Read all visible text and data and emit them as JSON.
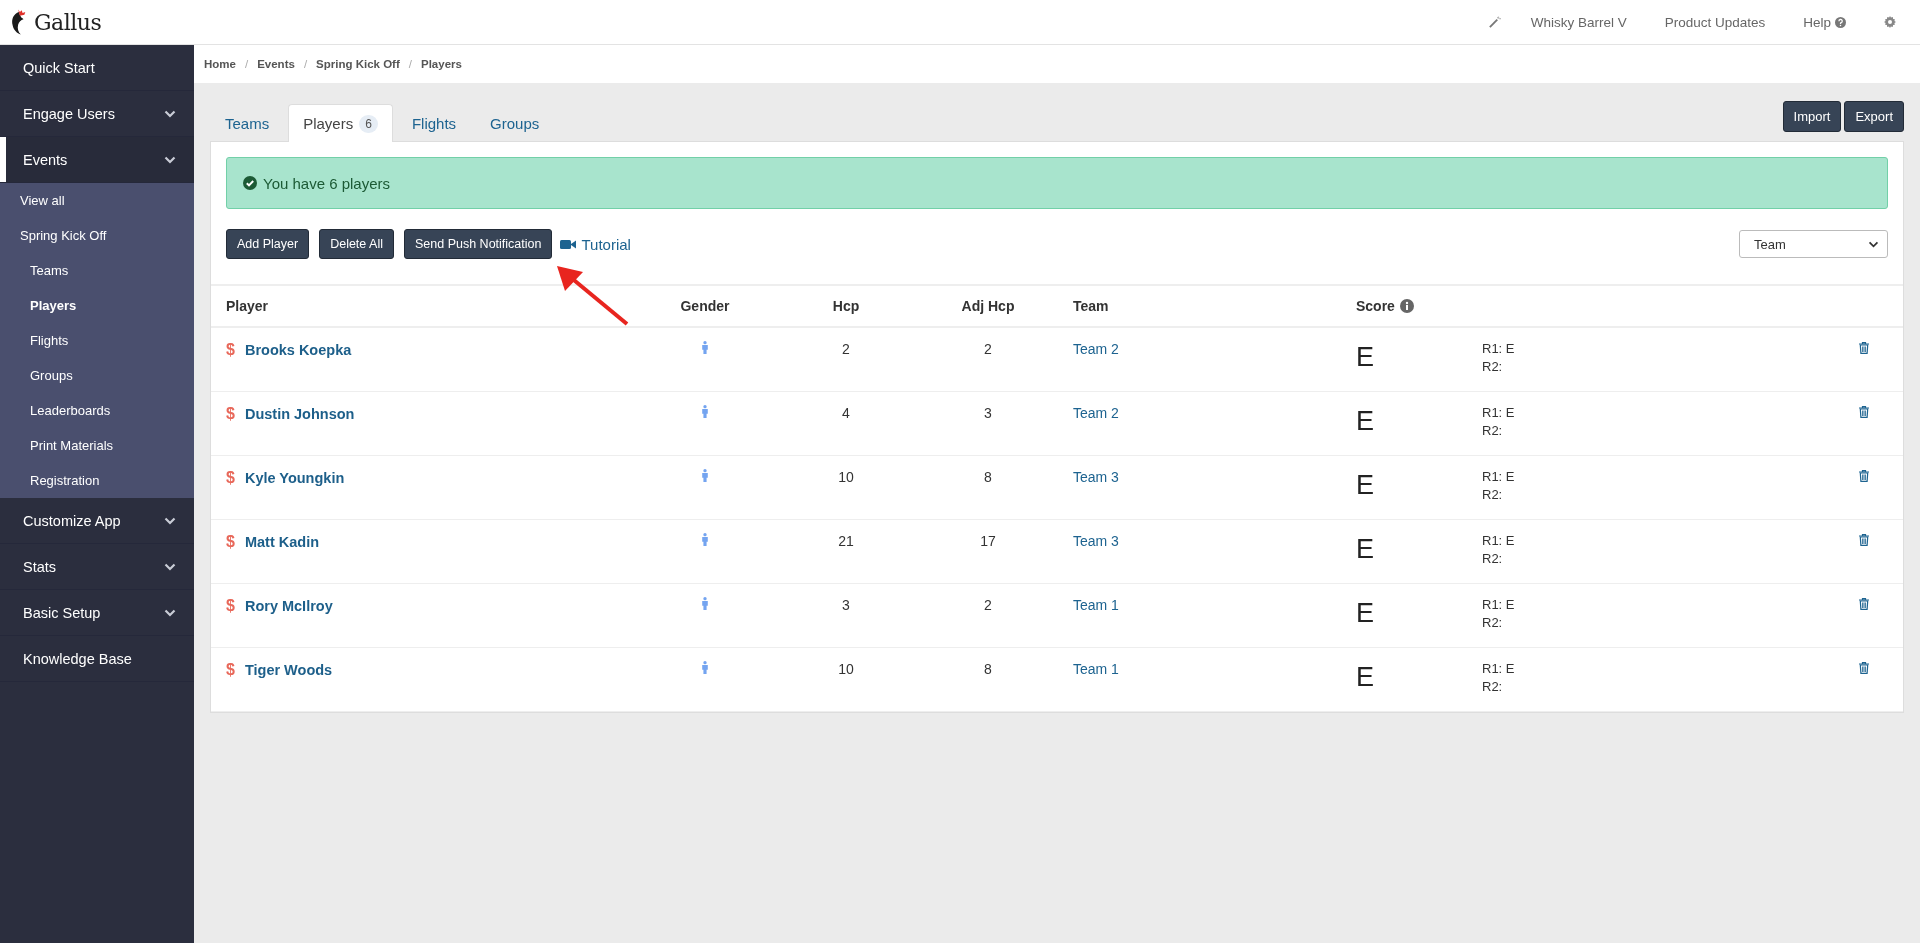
{
  "header": {
    "brand": "Gallus",
    "event_switcher": "Whisky Barrel V",
    "product_updates": "Product Updates",
    "help": "Help"
  },
  "sidebar": {
    "items": [
      {
        "label": "Quick Start",
        "has_menu": false,
        "selected": false
      },
      {
        "label": "Engage Users",
        "has_menu": true,
        "selected": false
      },
      {
        "label": "Events",
        "has_menu": true,
        "selected": true,
        "children": [
          {
            "label": "View all",
            "selected": false
          },
          {
            "label": "Spring Kick Off",
            "selected": false,
            "children": [
              {
                "label": "Teams",
                "selected": false
              },
              {
                "label": "Players",
                "selected": true
              },
              {
                "label": "Flights",
                "selected": false
              },
              {
                "label": "Groups",
                "selected": false
              },
              {
                "label": "Leaderboards",
                "selected": false
              },
              {
                "label": "Print Materials",
                "selected": false
              },
              {
                "label": "Registration",
                "selected": false
              }
            ]
          }
        ]
      },
      {
        "label": "Customize App",
        "has_menu": true,
        "selected": false
      },
      {
        "label": "Stats",
        "has_menu": true,
        "selected": false
      },
      {
        "label": "Basic Setup",
        "has_menu": true,
        "selected": false
      },
      {
        "label": "Knowledge Base",
        "has_menu": false,
        "selected": false
      }
    ]
  },
  "breadcrumb": [
    "Home",
    "Events",
    "Spring Kick Off",
    "Players"
  ],
  "breadcrumb_separator": "/",
  "tabs": [
    {
      "label": "Teams",
      "selected": false
    },
    {
      "label": "Players",
      "selected": true,
      "count": "6"
    },
    {
      "label": "Flights",
      "selected": false
    },
    {
      "label": "Groups",
      "selected": false
    }
  ],
  "page_buttons": [
    "Import",
    "Export"
  ],
  "alert": {
    "text": "You have 6 players"
  },
  "actions": {
    "buttons": [
      "Add Player",
      "Delete All",
      "Send Push Notification"
    ],
    "tutorial_link": "Tutorial"
  },
  "sort_select": {
    "value": "Team"
  },
  "annotation": {
    "kind": "arrow"
  },
  "table": {
    "columns": [
      "Player",
      "Gender",
      "Hcp",
      "Adj Hcp",
      "Team",
      "Score"
    ],
    "rows": [
      {
        "symbol": "$",
        "player": "Brooks Koepka",
        "gender": {
          "kind": "male"
        },
        "hcp": "2",
        "adj_hcp": "2",
        "team": "Team 2",
        "score": "E",
        "rounds": [
          "R1: E",
          "R2:"
        ]
      },
      {
        "symbol": "$",
        "player": "Dustin Johnson",
        "gender": {
          "kind": "male"
        },
        "hcp": "4",
        "adj_hcp": "3",
        "team": "Team 2",
        "score": "E",
        "rounds": [
          "R1: E",
          "R2:"
        ]
      },
      {
        "symbol": "$",
        "player": "Kyle Youngkin",
        "gender": {
          "kind": "male"
        },
        "hcp": "10",
        "adj_hcp": "8",
        "team": "Team 3",
        "score": "E",
        "rounds": [
          "R1: E",
          "R2:"
        ]
      },
      {
        "symbol": "$",
        "player": "Matt Kadin",
        "gender": {
          "kind": "male"
        },
        "hcp": "21",
        "adj_hcp": "17",
        "team": "Team 3",
        "score": "E",
        "rounds": [
          "R1: E",
          "R2:"
        ]
      },
      {
        "symbol": "$",
        "player": "Rory McIlroy",
        "gender": {
          "kind": "male"
        },
        "hcp": "3",
        "adj_hcp": "2",
        "team": "Team 1",
        "score": "E",
        "rounds": [
          "R1: E",
          "R2:"
        ]
      },
      {
        "symbol": "$",
        "player": "Tiger Woods",
        "gender": {
          "kind": "male"
        },
        "hcp": "10",
        "adj_hcp": "8",
        "team": "Team 1",
        "score": "E",
        "rounds": [
          "R1: E",
          "R2:"
        ]
      }
    ]
  }
}
